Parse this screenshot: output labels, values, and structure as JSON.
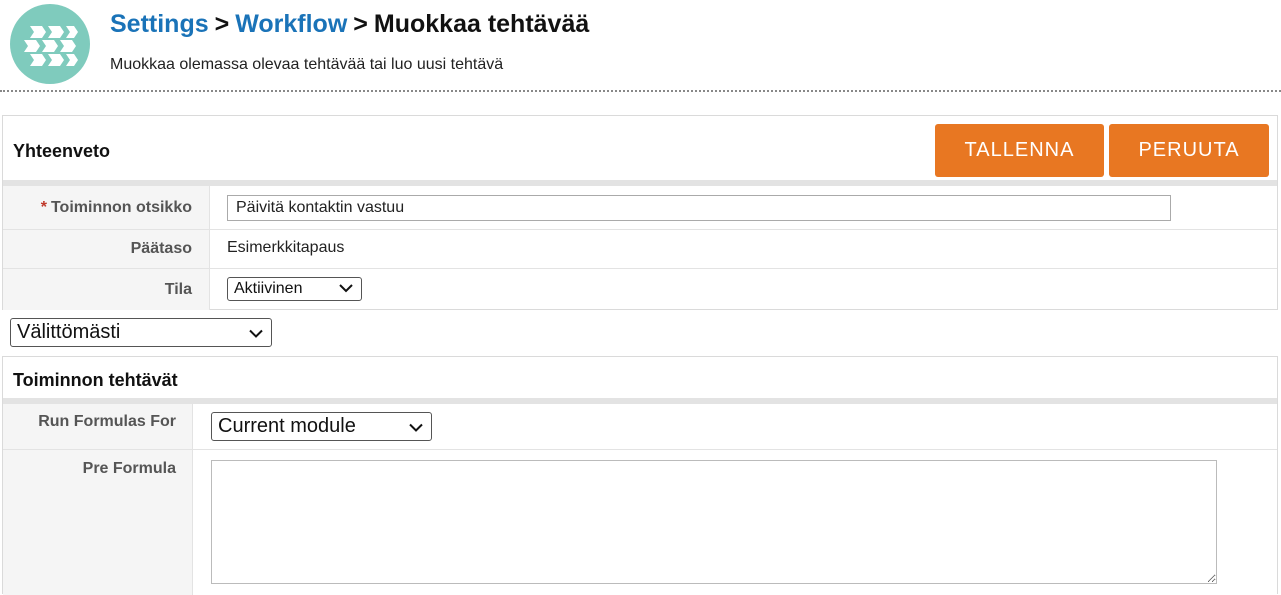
{
  "header": {
    "breadcrumb": {
      "settings": "Settings",
      "separator1": ">",
      "workflow": "Workflow",
      "separator2": ">",
      "current": "Muokkaa tehtävää"
    },
    "subtitle": "Muokkaa olemassa olevaa tehtävää tai luo uusi tehtävä"
  },
  "summary": {
    "title": "Yhteenveto",
    "save_label": "TALLENNA",
    "cancel_label": "PERUUTA",
    "required_marker": "*",
    "fields": {
      "action_title_label": "Toiminnon otsikko",
      "action_title_value": "Päivitä kontaktin vastuu",
      "parent_label": "Päätaso",
      "parent_value": "Esimerkkitapaus",
      "status_label": "Tila",
      "status_value": "Aktiivinen"
    }
  },
  "trigger_select": {
    "value": "Välittömästi"
  },
  "tasks": {
    "title": "Toiminnon tehtävät",
    "run_formulas_label": "Run Formulas For",
    "run_formulas_value": "Current module",
    "pre_formula_label": "Pre Formula",
    "pre_formula_value": ""
  },
  "colors": {
    "accent": "#e87722",
    "link": "#1a73b8",
    "logo": "#7fcbbd"
  },
  "icons": [
    "logo-icon",
    "chevron-down-icon",
    "resize-grip-icon"
  ]
}
